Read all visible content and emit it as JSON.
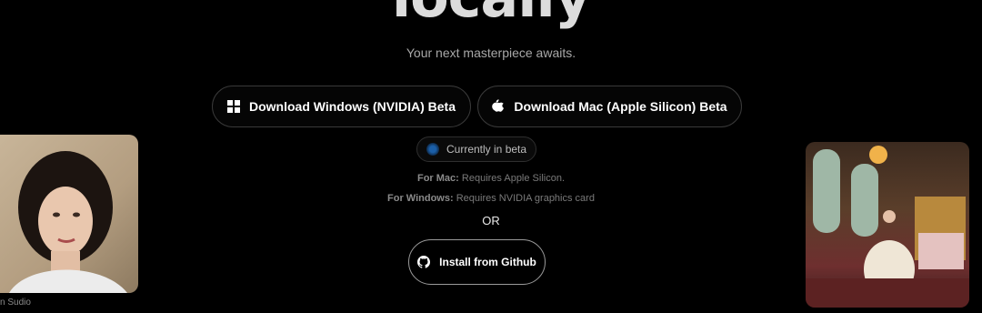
{
  "hero": {
    "title": "locally",
    "tagline": "Your next masterpiece awaits."
  },
  "downloads": {
    "windows_label": "Download Windows (NVIDIA) Beta",
    "mac_label": "Download Mac (Apple Silicon) Beta"
  },
  "beta_badge": {
    "label": "Currently in beta"
  },
  "requirements": {
    "mac_prefix": "For Mac:",
    "mac_text": "Requires Apple Silicon.",
    "win_prefix": "For Windows:",
    "win_text": "Requires NVIDIA graphics card"
  },
  "or_label": "OR",
  "github": {
    "label": "Install from Github"
  },
  "gallery": {
    "left_caption": "n Sudio"
  },
  "colors": {
    "background": "#000000",
    "beta_dot": "#1b5fa8"
  },
  "icons": [
    "windows-icon",
    "apple-icon",
    "github-icon"
  ]
}
